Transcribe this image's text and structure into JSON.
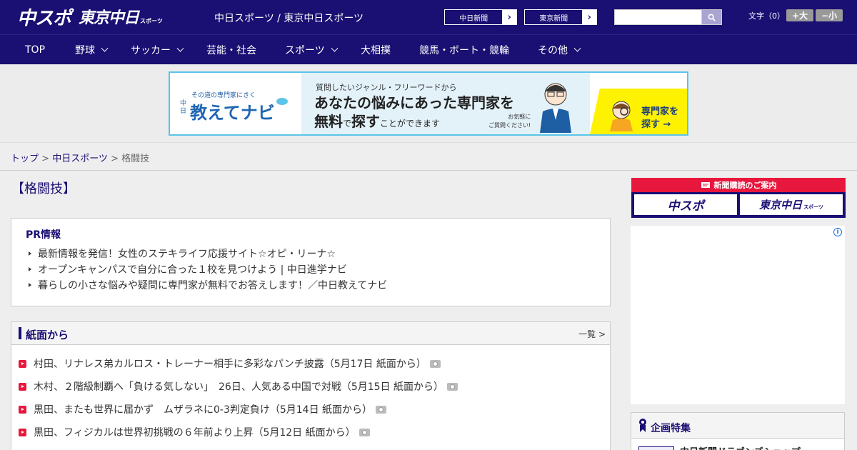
{
  "header": {
    "logo_chuspo": "中スポ",
    "logo_tokyo": "東京中日",
    "logo_tokyo_sub": "スポーツ",
    "site_title": "中日スポーツ / 東京中日スポーツ",
    "paper_links": [
      {
        "label": "中日新聞"
      },
      {
        "label": "東京新聞"
      }
    ],
    "search": {
      "placeholder": "",
      "value": ""
    },
    "font_size": {
      "label": "文字（0）",
      "up": "+大",
      "down": "−小"
    }
  },
  "nav": {
    "items": [
      {
        "label": "TOP",
        "has_dropdown": false
      },
      {
        "label": "野球",
        "has_dropdown": true
      },
      {
        "label": "サッカー",
        "has_dropdown": true
      },
      {
        "label": "芸能・社会",
        "has_dropdown": false
      },
      {
        "label": "スポーツ",
        "has_dropdown": true
      },
      {
        "label": "大相撲",
        "has_dropdown": false
      },
      {
        "label": "競馬・ボート・競輪",
        "has_dropdown": false
      },
      {
        "label": "その他",
        "has_dropdown": true
      }
    ]
  },
  "banner": {
    "brand_small": "その道の専門家にきく",
    "brand_side": "中日",
    "brand": "教えてナビ",
    "question": "質問したいジャンル・フリーワードから",
    "headline1": "あなたの悩みにあった専門家を",
    "headline2_a": "無料",
    "headline2_b": "で",
    "headline2_c": "探す",
    "headline2_d": "ことができます",
    "note1": "お気軽に",
    "note2": "ご質問ください!",
    "cta1": "専門家を",
    "cta2": "探す →"
  },
  "breadcrumb": {
    "home": "トップ",
    "section": "中日スポーツ",
    "current": "格闘技",
    "sep": " > "
  },
  "main": {
    "page_title": "【格闘技】",
    "pr": {
      "heading": "PR情報",
      "items": [
        "最新情報を発信！女性のステキライフ応援サイト☆オピ・リーナ☆",
        "オープンキャンパスで自分に合った１校を見つけよう | 中日進学ナビ",
        "暮らしの小さな悩みや疑問に専門家が無料でお答えします！／中日教えてナビ"
      ]
    },
    "paper": {
      "heading": "紙面から",
      "more": "一覧 >",
      "items": [
        "村田、リナレス弟カルロス・トレーナー相手に多彩なパンチ披露（5月17日 紙面から）",
        "木村、２階級制覇へ「負ける気しない」　26日、人気ある中国で対戦（5月15日 紙面から）",
        "黒田、またも世界に届かず　ムザラネに0-3判定負け（5月14日 紙面から）",
        "黒田、フィジカルは世界初挑戦の６年前より上昇（5月12日 紙面から）"
      ]
    }
  },
  "sidebar": {
    "subscribe_heading": "新聞購読のご案内",
    "logo_chuspo": "中スポ",
    "logo_tokyo": "東京中日",
    "logo_tokyo_sub": "スポーツ",
    "ad_info": "i",
    "feature_heading": "企画特集",
    "feature_item": "中日新聞ドラゴンズショップ"
  }
}
